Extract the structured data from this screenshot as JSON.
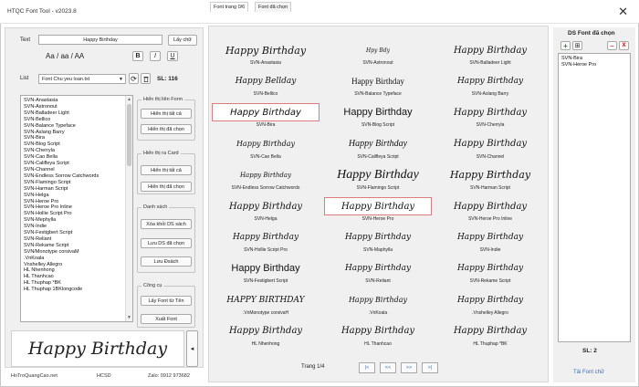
{
  "window": {
    "title": "HTQC Font Tool - v2023.8",
    "close_glyph": "✕"
  },
  "left": {
    "text_label": "Text",
    "text_value": "Happy Birthday",
    "get_word_button": "Lấy chữ",
    "case_options": "Aa / aa  / AA",
    "bold": "B",
    "italic": "I",
    "underline": "U",
    "list_label": "List",
    "list_select": "Font Chu yeu loan.txt",
    "sl_label": "SL: 116",
    "font_list": [
      "SVN-Anastasia",
      "SVN-Astronout",
      "SVN-Balladeer Light",
      "SVN-Bellico",
      "SVN-Balance Typeface",
      "SVN-Aslang Barry",
      "SVN-Bira",
      "SVN-Blog Script",
      "SVN-Cherryla",
      "SVN-Cao Bella",
      "SVN-Califleya Script",
      "SVN-Channel",
      "SVN-Endless Sorrow Catchwords",
      "SVN-Flamingo Script",
      "SVN-Harman Script",
      "SVN-Helga",
      "SVN-Heroe Pro",
      "SVN-Heroe Pro Inline",
      "SVN-Hollie Script Pro",
      "SVN-Mephylla",
      "SVN-Indie",
      "SVN-Festigbert Script",
      "SVN-Reliant",
      "SVN-Rekame Script",
      "SVN/Monotype corsivaM",
      ".VnKoala",
      "Vnshelley Allegro",
      "HL Nhenhong",
      "HL Thanhcao",
      "HL Thuphap *BK",
      "HL Thuphap 1BKlongcode"
    ],
    "group_font": {
      "label": "Hiển thị liên Form",
      "btn1": "Hiển thị tất cả",
      "btn2": "Hiển thị đã chọn"
    },
    "group_card": {
      "label": "Hiển thị ra Card",
      "btn1": "Hiển thị tất cả",
      "btn2": "Hiển thị đã chọn"
    },
    "group_list": {
      "label": "Danh sách",
      "btn1": "Xóa khỏi DS sách",
      "btn2": "Lưu DS đã chọn",
      "btn3": "Lưu Đsách"
    },
    "group_tools": {
      "label": "Công cụ",
      "btn1": "Lấy Font từ Tên",
      "btn2": "Xuất Font"
    },
    "preview_text": "Happy Birthday",
    "collapse_glyph": "◂"
  },
  "status": {
    "site": "HoTroQuangCao.net",
    "author": "HCSD",
    "phone": "Zalo: 0912 973682"
  },
  "middle": {
    "tabs": [
      "Font trang 0/6",
      "Font đã chọn"
    ],
    "page_label": "Trang 1/4",
    "pager_buttons": [
      "|<",
      "<<",
      ">>",
      ">|"
    ],
    "cells": [
      {
        "preview": "Happy Birthday",
        "name": "SVN-Anastasia",
        "font": "\"DejaVu Serif\", serif",
        "style": "italic",
        "size": 11,
        "selected": false
      },
      {
        "preview": "Hpy Bdy",
        "name": "SVN-Astronout",
        "font": "\"DejaVu Serif\", serif",
        "style": "italic",
        "size": 6,
        "selected": false
      },
      {
        "preview": "Happy Birthday",
        "name": "SVN-Balladeer Light",
        "font": "\"DejaVu Serif\", serif",
        "style": "italic",
        "size": 10,
        "selected": false
      },
      {
        "preview": "Happy Bellday",
        "name": "SVN-Bellico",
        "font": "\"DejaVu Serif\", serif",
        "style": "italic",
        "size": 9,
        "selected": false
      },
      {
        "preview": "Happy Birthday",
        "name": "SVN-Balance Typeface",
        "font": "\"Liberation Serif\", serif",
        "style": "normal",
        "size": 9,
        "selected": false
      },
      {
        "preview": "Happy Birthday",
        "name": "SVN-Aslang Barry",
        "font": "\"DejaVu Serif\", serif",
        "style": "italic",
        "size": 9,
        "selected": false
      },
      {
        "preview": "Happy Birthday",
        "name": "SVN-Bira",
        "font": "\"DejaVu Sans\", sans-serif",
        "style": "italic",
        "size": 10,
        "selected": true
      },
      {
        "preview": "Happy Birthday",
        "name": "SVN-Blog Script",
        "font": "\"Liberation Sans\", sans-serif",
        "style": "normal",
        "size": 11,
        "selected": false
      },
      {
        "preview": "Happy Birthday",
        "name": "SVN-Cherryla",
        "font": "\"DejaVu Serif\", serif",
        "style": "italic",
        "size": 10,
        "selected": false
      },
      {
        "preview": "Happy Birthday",
        "name": "SVN-Cao Bella",
        "font": "\"DejaVu Serif\", serif",
        "style": "italic",
        "size": 8,
        "selected": false
      },
      {
        "preview": "Happy Birthday",
        "name": "SVN-Califleya Script",
        "font": "\"Liberation Serif\", serif",
        "style": "italic",
        "size": 10,
        "selected": false
      },
      {
        "preview": "Happy Birthday",
        "name": "SVN-Channel",
        "font": "\"DejaVu Serif\", serif",
        "style": "italic",
        "size": 10,
        "selected": false
      },
      {
        "preview": "Happy Birthday",
        "name": "SVN-Endless Sorrow Catchwords",
        "font": "\"DejaVu Serif\", serif",
        "style": "italic",
        "size": 7,
        "selected": false
      },
      {
        "preview": "Happy Birthday",
        "name": "SVN-Flamingo Script",
        "font": "\"Liberation Serif\", serif",
        "style": "italic",
        "size": 14,
        "selected": false
      },
      {
        "preview": "Happy Birthday",
        "name": "SVN-Harman Script",
        "font": "\"DejaVu Serif\", serif",
        "style": "italic",
        "size": 11,
        "selected": false
      },
      {
        "preview": "Happy Birthday",
        "name": "SVN-Helga",
        "font": "\"DejaVu Serif\", serif",
        "style": "italic",
        "size": 10,
        "selected": false
      },
      {
        "preview": "Happy Birthday",
        "name": "SVN-Heroe Pro",
        "font": "\"DejaVu Serif\", serif",
        "style": "italic",
        "size": 10,
        "selected": true
      },
      {
        "preview": "Happy Birthday",
        "name": "SVN-Heroe Pro Inline",
        "font": "\"DejaVu Serif\", serif",
        "style": "italic",
        "size": 10,
        "selected": false
      },
      {
        "preview": "Happy Birthday",
        "name": "SVN-Hollie Script Pro",
        "font": "\"DejaVu Serif\", serif",
        "style": "italic",
        "size": 9,
        "selected": false
      },
      {
        "preview": "Happy Birthday",
        "name": "SVN-Maphylla",
        "font": "\"DejaVu Serif\", serif",
        "style": "italic",
        "size": 9,
        "selected": false
      },
      {
        "preview": "Happy Birthday",
        "name": "SVN-Indie",
        "font": "\"DejaVu Serif\", serif",
        "style": "italic",
        "size": 9,
        "selected": false
      },
      {
        "preview": "Happy Birthday",
        "name": "SVN-Festigbert Script",
        "font": "\"Liberation Sans\", sans-serif",
        "style": "normal",
        "size": 11,
        "selected": false
      },
      {
        "preview": "Happy Birthday",
        "name": "SVN-Reliant",
        "font": "\"DejaVu Serif\", serif",
        "style": "italic",
        "size": 9,
        "selected": false
      },
      {
        "preview": "Happy Birthday",
        "name": "SVN-Rekame Script",
        "font": "\"DejaVu Serif\", serif",
        "style": "italic",
        "size": 9,
        "selected": false
      },
      {
        "preview": "HAPPY BIRTHDAY",
        "name": ".VnMonotype corsivaH",
        "font": "\"DejaVu Serif\", serif",
        "style": "italic",
        "size": 9,
        "selected": false
      },
      {
        "preview": "Happy Birthday",
        "name": ".VnKoala",
        "font": "\"DejaVu Serif\", serif",
        "style": "italic",
        "size": 8,
        "selected": false
      },
      {
        "preview": "Happy Birthday",
        "name": ".Vnshelley Allegro",
        "font": "\"DejaVu Serif\", serif",
        "style": "italic",
        "size": 9,
        "selected": false
      },
      {
        "preview": "Happy Birthday",
        "name": "HL Nhenhong",
        "font": "\"DejaVu Serif\", serif",
        "style": "italic",
        "size": 10,
        "selected": false
      },
      {
        "preview": "Happy Birthday",
        "name": "HL Thanhcao",
        "font": "\"DejaVu Serif\", serif",
        "style": "italic",
        "size": 10,
        "selected": false
      },
      {
        "preview": "Happy Birthday",
        "name": "HL Thuphap *BK",
        "font": "\"DejaVu Serif\", serif",
        "style": "italic",
        "size": 10,
        "selected": false
      }
    ]
  },
  "right": {
    "title": "DS Font đã chọn",
    "add_glyph": "+",
    "save_glyph": "⊞",
    "minus_glyph": "−",
    "close_glyph": "X",
    "items": [
      "SVN-Bira",
      "SVN-Heroe Pro"
    ],
    "count": "SL: 2",
    "link": "Tải Font chữ"
  }
}
